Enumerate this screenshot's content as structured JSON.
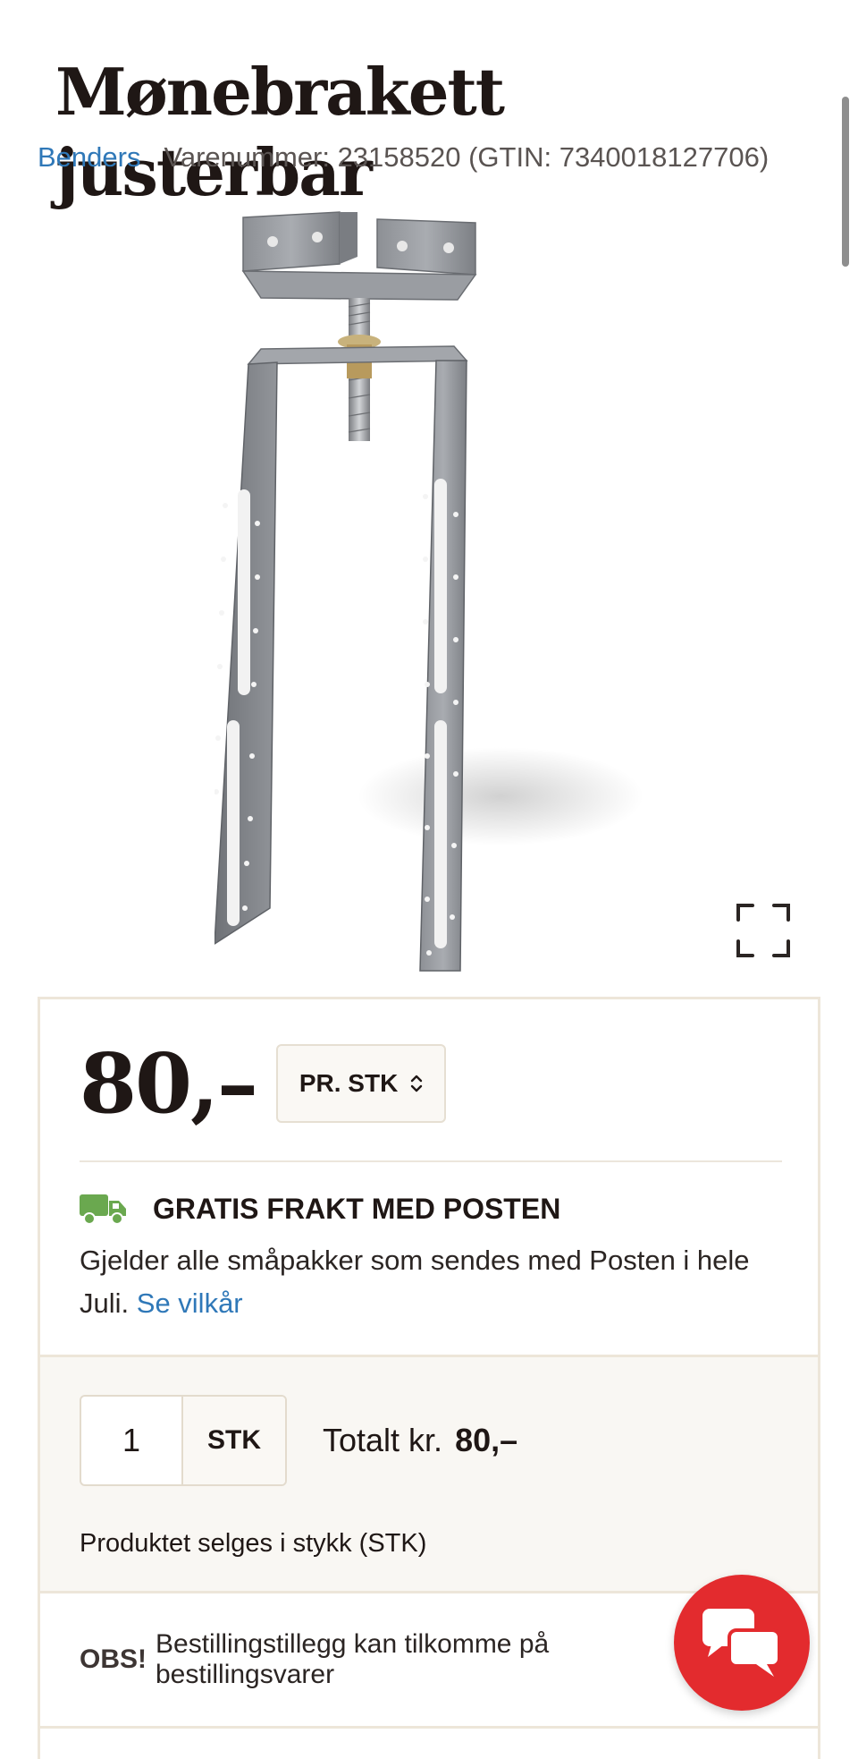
{
  "product": {
    "title": "Mønebrakett justerbar",
    "brand": "Benders",
    "sku_text": "Varenummer: 23158520 (GTIN: 7340018127706)"
  },
  "pricing": {
    "price": "80,–",
    "unit_select": "PR. STK"
  },
  "shipping": {
    "heading": "GRATIS FRAKT MED POSTEN",
    "body": "Gjelder alle småpakker som sendes med Posten i hele Juli.",
    "link": "Se vilkår"
  },
  "quantity": {
    "value": "1",
    "unit": "STK",
    "total_label": "Totalt kr.",
    "total_value": "80,–",
    "note": "Produktet selges i stykk (STK)"
  },
  "notice": {
    "label": "OBS!",
    "text": "Bestillingstillegg kan tilkomme på bestillingsvarer"
  },
  "icons": {
    "truck": "truck-icon",
    "expand": "fullscreen-icon",
    "chat": "chat-icon",
    "select_arrows": "chevron-updown-icon"
  },
  "colors": {
    "link": "#2f78b8",
    "truck": "#6aa84f",
    "chat_button": "#e32b2e",
    "panel_border": "#ede6d9"
  }
}
